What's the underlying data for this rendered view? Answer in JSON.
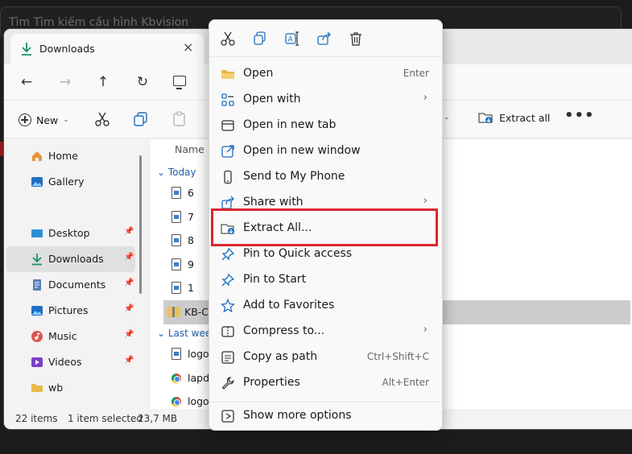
{
  "background": {
    "search_text": "Tìm Tìm kiếm cấu hình Kbvision"
  },
  "explorer": {
    "tab_title": "Downloads",
    "tab_close": "×",
    "new_label": "New",
    "extract_all_label": "Extract all",
    "more_label": "•••",
    "sidebar": [
      {
        "label": "Home",
        "icon": "home-icon"
      },
      {
        "label": "Gallery",
        "icon": "gallery-icon"
      },
      {
        "label": "Desktop",
        "icon": "desktop-icon"
      },
      {
        "label": "Downloads",
        "icon": "download-icon"
      },
      {
        "label": "Documents",
        "icon": "documents-icon"
      },
      {
        "label": "Pictures",
        "icon": "pictures-icon"
      },
      {
        "label": "Music",
        "icon": "music-icon"
      },
      {
        "label": "Videos",
        "icon": "videos-icon"
      },
      {
        "label": "wb",
        "icon": "folder-icon"
      }
    ],
    "column_name": "Name",
    "groups": {
      "today": "Today",
      "last_week": "Last week"
    },
    "files_today": [
      "6",
      "7",
      "8",
      "9",
      "1"
    ],
    "selected_file": "KB-Co",
    "files_last_week": [
      "logo-",
      "lapda",
      "logo-t"
    ],
    "status": {
      "items": "22 items",
      "selected": "1 item selected",
      "size": "23,7 MB"
    }
  },
  "context_menu": {
    "items": [
      {
        "label": "Open",
        "shortcut": "Enter"
      },
      {
        "label": "Open with",
        "arrow": "›"
      },
      {
        "label": "Open in new tab"
      },
      {
        "label": "Open in new window"
      },
      {
        "label": "Send to My Phone"
      },
      {
        "label": "Share with",
        "arrow": "›"
      },
      {
        "label": "Extract All..."
      },
      {
        "label": "Pin to Quick access"
      },
      {
        "label": "Pin to Start"
      },
      {
        "label": "Add to Favorites"
      },
      {
        "label": "Compress to...",
        "arrow": "›"
      },
      {
        "label": "Copy as path",
        "shortcut": "Ctrl+Shift+C"
      },
      {
        "label": "Properties",
        "shortcut": "Alt+Enter"
      },
      {
        "label": "Show more options"
      }
    ]
  },
  "colors": {
    "highlight": "#d9262c",
    "accent": "#1f6fc2"
  }
}
